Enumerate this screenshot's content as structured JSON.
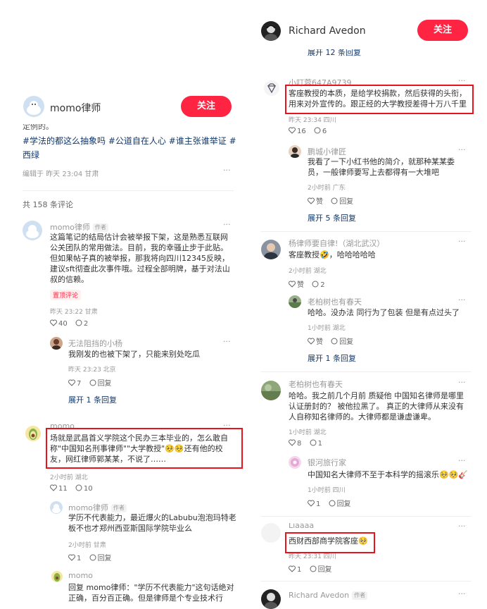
{
  "left": {
    "header": {
      "name": "momo律师",
      "follow": "关注"
    },
    "post_tail_partial": "定例的。",
    "hashtags": "#学法的都这么抽象吗 #公道自在人心 #谁主张谁举证 #西绿",
    "edit_meta": "编辑于 昨天 23:04 甘肃",
    "total_comments": "共 158 条评论",
    "c1": {
      "name": "momo律师",
      "author_badge": "作者",
      "text": "这篇笔记的结局估计会被举报下架，这是熟悉互联网公关团队的常用做法。目前，我的幸骚止步于此贴。但如果帖子真的被举报，那我将向四川12345反映，建议sft彻查此次事件哦。过程全部明牌，基于对法山叔的信赖。",
      "pin": "置顶评论",
      "meta": "昨天 23:22 甘肃",
      "likes": "40",
      "replies": "2",
      "reply1": {
        "name": "无法阻挡的小杨",
        "text": "我刚发的也被下架了，只能来别处吃瓜",
        "meta": "昨天 23:23 北京",
        "likes": "7",
        "reply_label": "回复"
      },
      "expand": "展开 1 条回复"
    },
    "c2": {
      "name": "momo",
      "text": "场就是武昌首义学院这个民办三本毕业的，怎么敢自称\"中国知名刑事律师\"\"大学教授\"🥺🥺还有他的校友，网红律师郭某某，不说了……",
      "meta": "2小时前 湖北",
      "likes": "11",
      "replies": "10",
      "reply1": {
        "name": "momo律师",
        "author_badge": "作者",
        "text": "学历不代表能力，最近爆火的Labubu泡泡玛特老板不也才郑州西亚斯国际学院毕业么",
        "meta": "2小时前 甘肃",
        "likes": "1",
        "reply_label": "回复"
      },
      "reply2": {
        "name": "momo",
        "text": "回复 momo律师：\"学历不代表能力\"这句话绝对正确，百分百正确。但是律师是个专业技术行"
      }
    }
  },
  "right": {
    "header": {
      "name": "Richard Avedon",
      "follow": "关注"
    },
    "expand_top": "展开 12 条回复",
    "c1": {
      "name": "小叮蓉647A9739",
      "text": "客座教授的本质，是给学校捐款，然后获得的头衔，用来对外宣传的。跟正经的大学教授差得十万八千里",
      "meta": "昨天 23:34 四川",
      "likes": "16",
      "replies": "6",
      "reply1": {
        "name": "鹏城小律匠",
        "text": "我看了一下小红书他的简介，就那种某某委员，一般律师要写上去都得有一大堆吧",
        "meta": "2小时前 广东",
        "like_label": "赞",
        "reply_label": "回复"
      },
      "expand": "展开 5 条回复"
    },
    "c2": {
      "name": "杨律师要自律!（湖北武汉）",
      "text": "客座教授🤣，哈哈哈哈哈",
      "meta": "2小时前 湖北",
      "like_label": "赞",
      "replies": "2",
      "reply1": {
        "name": "老柏树也有春天",
        "text": "哈哈。没办法 同行为了包装 但是有点过头了",
        "meta": "1小时前 湖北",
        "like_label": "赞",
        "reply_label": "回复"
      },
      "expand": "展开 1 条回复"
    },
    "c3": {
      "name": "老柏树也有春天",
      "text": "哈哈。我之前几个月前 质疑他 中国知名律师是哪里认证册封的？ 被他拉黑了。 真正的大律师从来没有人自称知名律师的。大律师都是谦虚谦卑。",
      "meta": "1小时前 湖北",
      "likes": "8",
      "replies": "1",
      "reply1": {
        "name": "银河旅行家",
        "text": "中国知名大律师不至于本科学的摇滚乐🥺🥺🎸",
        "meta": "1小时前 四川",
        "likes": "1",
        "reply_label": "回复"
      }
    },
    "c4": {
      "name": "Liaaaa",
      "text": "西财西部商学院客座🥺",
      "meta": "昨天 23:31 四川",
      "likes": "1",
      "reply_label": "回复"
    },
    "c5": {
      "name": "Richard Avedon",
      "author_badge": "作者"
    }
  },
  "colors": {
    "accent": "#ff2442",
    "link": "#13386c",
    "highlight_box": "#e8141b"
  }
}
